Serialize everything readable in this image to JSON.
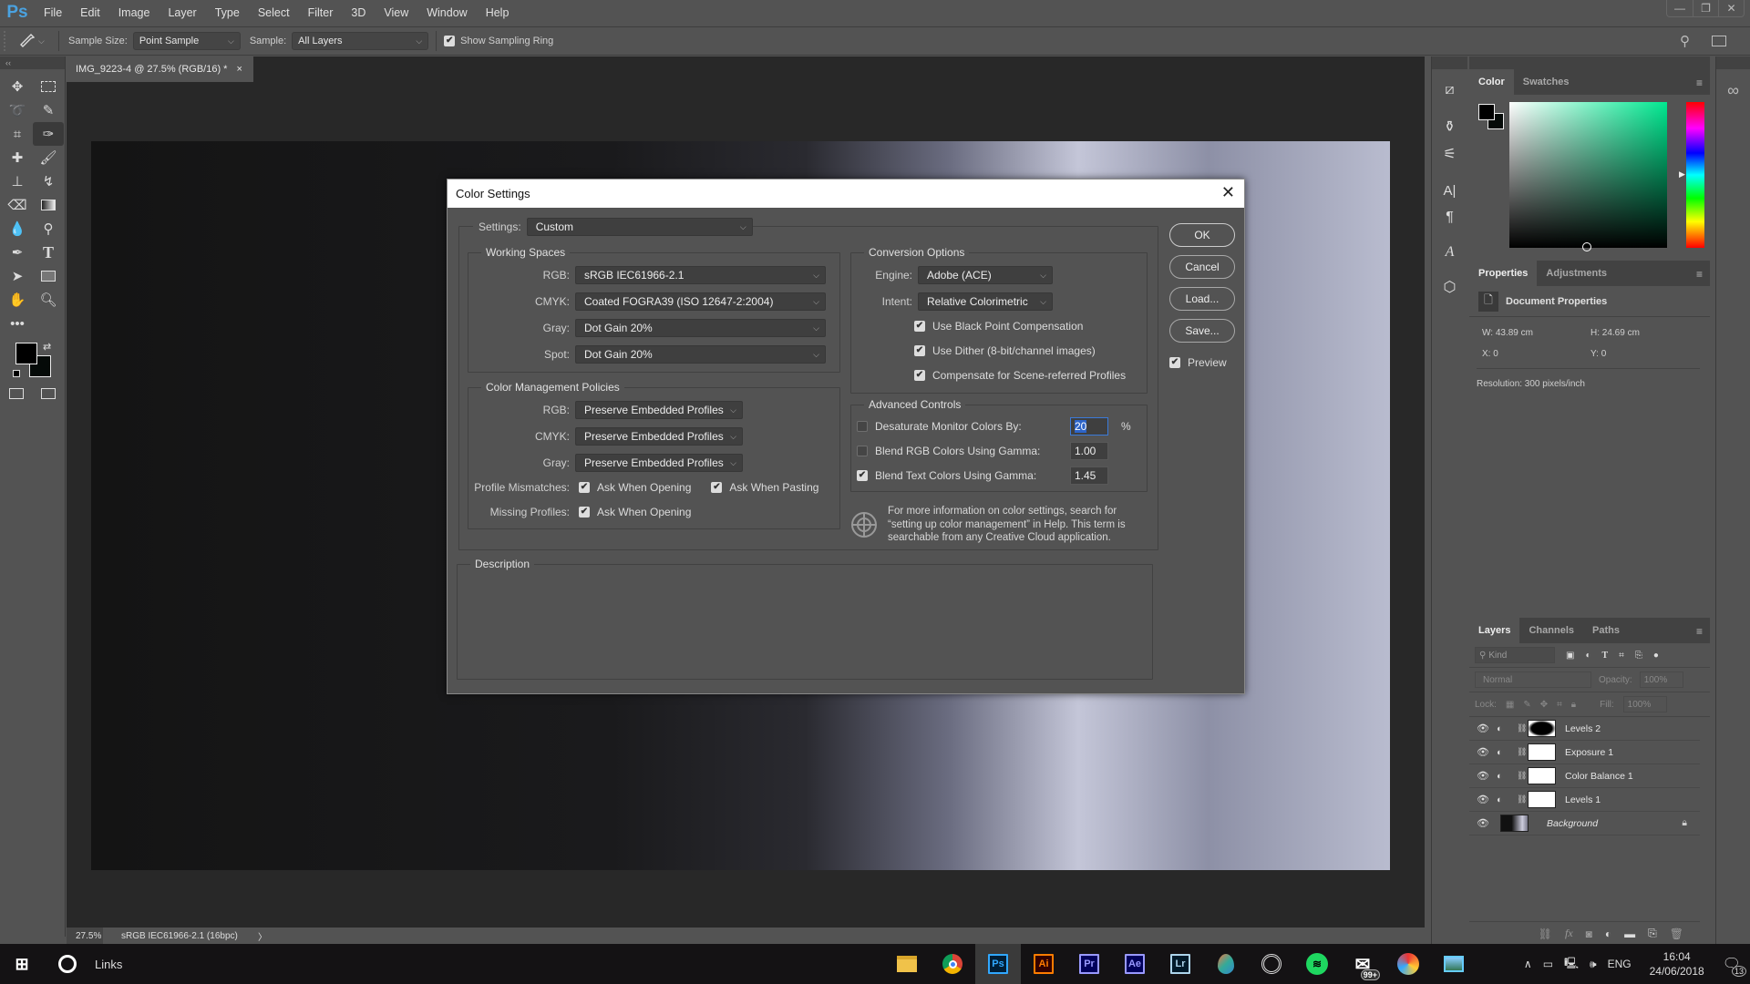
{
  "app": {
    "logo": "Ps",
    "menu": [
      "File",
      "Edit",
      "Image",
      "Layer",
      "Type",
      "Select",
      "Filter",
      "3D",
      "View",
      "Window",
      "Help"
    ]
  },
  "window_controls": {
    "minimize": "—",
    "restore": "❐",
    "close": "✕"
  },
  "options_bar": {
    "tool_icon": "eyedropper-icon",
    "sample_size_label": "Sample Size:",
    "sample_size_value": "Point Sample",
    "sample_label": "Sample:",
    "sample_value": "All Layers",
    "show_sampling_ring_label": "Show Sampling Ring",
    "show_sampling_ring_checked": true
  },
  "document": {
    "tab_title": "IMG_9223-4 @ 27.5% (RGB/16) *",
    "tab_close": "×",
    "status_zoom": "27.5%",
    "status_profile": "sRGB IEC61966-2.1 (16bpc)",
    "status_arrow": "〉"
  },
  "toolbar": {
    "collapse": "‹‹",
    "more": "•••"
  },
  "dialog": {
    "title": "Color Settings",
    "settings_label": "Settings:",
    "settings_value": "Custom",
    "working_spaces": {
      "legend": "Working Spaces",
      "rows": [
        {
          "label": "RGB:",
          "value": "sRGB IEC61966-2.1"
        },
        {
          "label": "CMYK:",
          "value": "Coated FOGRA39 (ISO 12647-2:2004)"
        },
        {
          "label": "Gray:",
          "value": "Dot Gain 20%"
        },
        {
          "label": "Spot:",
          "value": "Dot Gain 20%"
        }
      ]
    },
    "policies": {
      "legend": "Color Management Policies",
      "rows": [
        {
          "label": "RGB:",
          "value": "Preserve Embedded Profiles"
        },
        {
          "label": "CMYK:",
          "value": "Preserve Embedded Profiles"
        },
        {
          "label": "Gray:",
          "value": "Preserve Embedded Profiles"
        }
      ],
      "mismatch_label": "Profile Mismatches:",
      "mismatch_open": "Ask When Opening",
      "mismatch_paste": "Ask When Pasting",
      "missing_label": "Missing Profiles:",
      "missing_open": "Ask When Opening"
    },
    "conversion": {
      "legend": "Conversion Options",
      "engine_label": "Engine:",
      "engine_value": "Adobe (ACE)",
      "intent_label": "Intent:",
      "intent_value": "Relative Colorimetric",
      "black_point": "Use Black Point Compensation",
      "dither": "Use Dither (8-bit/channel images)",
      "scene_referred": "Compensate for Scene-referred Profiles"
    },
    "advanced": {
      "legend": "Advanced Controls",
      "desaturate_label": "Desaturate Monitor Colors By:",
      "desaturate_value": "20",
      "desaturate_unit": "%",
      "desaturate_checked": false,
      "blend_rgb_label": "Blend RGB Colors Using Gamma:",
      "blend_rgb_value": "1.00",
      "blend_rgb_checked": false,
      "blend_text_label": "Blend Text Colors Using Gamma:",
      "blend_text_value": "1.45",
      "blend_text_checked": true
    },
    "info_text": "For more information on color settings, search for “setting up color management” in Help. This term is searchable from any Creative Cloud application.",
    "description_legend": "Description",
    "buttons": {
      "ok": "OK",
      "cancel": "Cancel",
      "load": "Load...",
      "save": "Save..."
    },
    "preview_label": "Preview",
    "preview_checked": true
  },
  "color_panel": {
    "tabs": [
      "Color",
      "Swatches"
    ],
    "hue_color": "#00e890"
  },
  "properties_panel": {
    "tabs": [
      "Properties",
      "Adjustments"
    ],
    "heading": "Document Properties",
    "w_label": "W:",
    "w_value": "43.89 cm",
    "h_label": "H:",
    "h_value": "24.69 cm",
    "x_label": "X:",
    "x_value": "0",
    "y_label": "Y:",
    "y_value": "0",
    "resolution": "Resolution: 300 pixels/inch"
  },
  "layers_panel": {
    "tabs": [
      "Layers",
      "Channels",
      "Paths"
    ],
    "kind_placeholder": "Kind",
    "blend_mode": "Normal",
    "opacity_label": "Opacity:",
    "opacity_value": "100%",
    "lock_label": "Lock:",
    "fill_label": "Fill:",
    "fill_value": "100%",
    "layers": [
      {
        "name": "Levels 2",
        "type": "adjustment"
      },
      {
        "name": "Exposure 1",
        "type": "adjustment"
      },
      {
        "name": "Color Balance 1",
        "type": "adjustment"
      },
      {
        "name": "Levels 1",
        "type": "adjustment"
      },
      {
        "name": "Background",
        "type": "image",
        "locked": true
      }
    ]
  },
  "taskbar": {
    "search_text": "Links",
    "apps": [
      "File Explorer",
      "Chrome",
      "Ps",
      "Ai",
      "Pr",
      "Ae",
      "Lr",
      "Maps",
      "App",
      "Spotify",
      "Mail",
      "DaVinci",
      "Photos"
    ],
    "mail_badge": "99+",
    "tray": {
      "language": "ENG",
      "time": "16:04",
      "date": "24/06/2018",
      "notifications": "13"
    }
  }
}
